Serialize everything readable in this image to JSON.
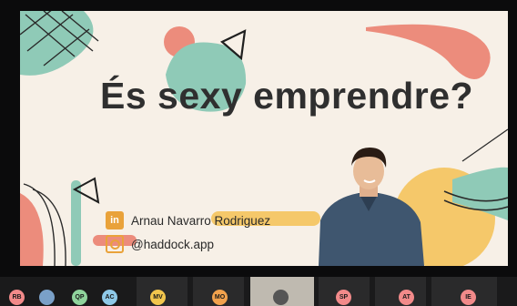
{
  "slide": {
    "title": "És sexy emprendre?",
    "name": "Arnau Navarro Rodriguez",
    "handle": "@haddock.app",
    "linkedin_icon": "linkedin-icon",
    "instagram_icon": "instagram-icon"
  },
  "participants": [
    {
      "initials": "RB",
      "color": "#f28a8a"
    },
    {
      "initials": "",
      "color": "#7aa0c8",
      "photo": true
    },
    {
      "initials": "QP",
      "color": "#8fd39c"
    },
    {
      "initials": "AC",
      "color": "#8ec9e8"
    },
    {
      "initials": "MV",
      "color": "#f2c64d"
    },
    {
      "initials": "MO",
      "color": "#f2a24d"
    },
    {
      "initials": "",
      "color": "#333",
      "video": true
    },
    {
      "initials": "SP",
      "color": "#f28a8a"
    },
    {
      "initials": "AT",
      "color": "#f28a8a"
    },
    {
      "initials": "IE",
      "color": "#f28a8a"
    }
  ],
  "colors": {
    "accent_orange": "#e9a23a",
    "bg": "#f7f0e7",
    "teal": "#8fcab7",
    "salmon": "#ec8c7c"
  }
}
